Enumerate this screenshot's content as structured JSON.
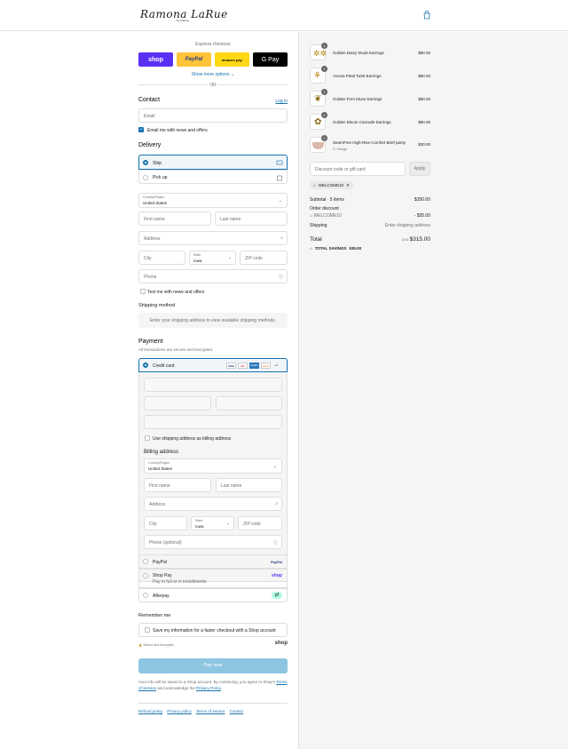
{
  "header": {
    "logo": "Ramona LaRue",
    "logo_sub": "by Arianne"
  },
  "express": {
    "label": "Express checkout",
    "buttons": [
      {
        "label": "shop",
        "bg": "#5a31f4",
        "fg": "#ffffff"
      },
      {
        "label": "PayPal",
        "bg": "#ffc439",
        "fg": "#253b80"
      },
      {
        "label": "amazon pay",
        "bg": "#ffd814",
        "fg": "#000000"
      },
      {
        "label": "G Pay",
        "bg": "#000000",
        "fg": "#ffffff"
      }
    ],
    "show_more": "Show more options ⌄",
    "or": "OR"
  },
  "contact": {
    "title": "Contact",
    "login": "Log in",
    "email_placeholder": "Email",
    "news_label": "Email me with news and offers"
  },
  "delivery": {
    "title": "Delivery",
    "ship": "Ship",
    "pickup": "Pick up",
    "country_label": "Country/Region",
    "country": "United States",
    "first_name": "First name",
    "last_name": "Last name",
    "address": "Address",
    "city": "City",
    "state_label": "State",
    "state": "Iowa",
    "zip": "ZIP code",
    "phone": "Phone",
    "text_me": "Text me with news and offers"
  },
  "shipping": {
    "title": "Shipping method",
    "note": "Enter your shipping address to view available shipping methods."
  },
  "payment": {
    "title": "Payment",
    "subtitle": "All transactions are secure and encrypted.",
    "credit_card": "Credit card",
    "card_brands": [
      "VISA",
      "MC",
      "AMEX",
      "DISC",
      "+4"
    ],
    "use_shipping": "Use shipping address as billing address",
    "billing_title": "Billing address",
    "phone_optional": "Phone (optional)",
    "paypal": "PayPal",
    "paypal_logo": "PayPal",
    "shoppay": "Shop Pay",
    "shoppay_sub": "Pay in full or in installments",
    "shoppay_logo": "shop",
    "afterpay": "Afterpay"
  },
  "remember": {
    "title": "Remember me",
    "save_label": "Save my information for a faster checkout with a Shop account",
    "secure": "Secure and encrypted",
    "shop_logo": "shop"
  },
  "pay_now": "Pay now",
  "legal": {
    "text1": "Your info will be saved to a Shop account. By continuing, you agree to Shop's",
    "terms": "Terms of Service",
    "and": "and acknowledge the",
    "privacy": "Privacy Policy",
    "period": "."
  },
  "footer_links": [
    "Refund policy",
    "Privacy policy",
    "Terms of service",
    "Contact"
  ],
  "order": {
    "items": [
      {
        "name": "Golden Daisy Studs Earrings",
        "variant": "",
        "price": "$80.00",
        "qty": "1"
      },
      {
        "name": "Aurora Petal Twist Earrings",
        "variant": "",
        "price": "$80.00",
        "qty": "1"
      },
      {
        "name": "Golden Fern Muse Earrings",
        "variant": "",
        "price": "$80.00",
        "qty": "1"
      },
      {
        "name": "Golden Bloom Cascade Earrings",
        "variant": "",
        "price": "$80.00",
        "qty": "1"
      },
      {
        "name": "SeamFree High-Rise Comfort Brief panty",
        "variant": "S / Beige",
        "price": "$30.00",
        "qty": "1"
      }
    ],
    "discount_placeholder": "Discount code or gift card",
    "apply": "Apply",
    "code": "WELCOME10",
    "subtotal_label": "Subtotal · 5 items",
    "subtotal": "$350.00",
    "order_discount": "Order discount",
    "discount_code": "WELCOME10",
    "discount_value": "- $35.00",
    "shipping_label": "Shipping",
    "shipping_value": "Enter shipping address",
    "total_label": "Total",
    "currency": "USD",
    "total": "$315.00",
    "savings_label": "TOTAL SAVINGS",
    "savings": "$35.00"
  },
  "colors": {
    "accent": "#1773b0",
    "pay_button": "#8ec5e0"
  }
}
